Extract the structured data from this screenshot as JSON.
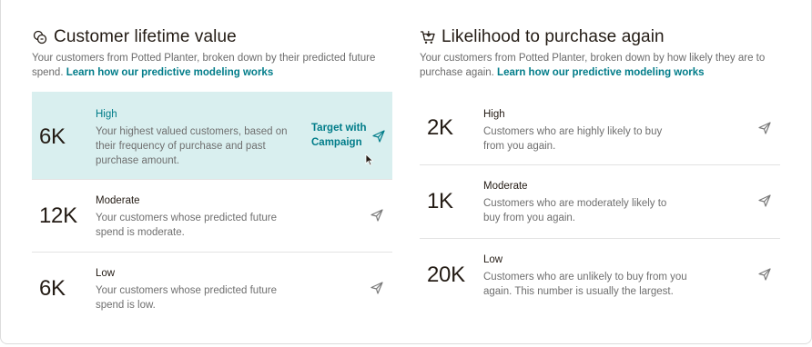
{
  "clv": {
    "icon": "coins-icon",
    "title": "Customer lifetime value",
    "desc": "Your customers from Potted Planter, broken down by their predicted future spend.",
    "link": "Learn how our predictive modeling works",
    "rows": [
      {
        "value": "6K",
        "label": "High",
        "desc": "Your highest valued customers, based on their frequency of purchase and past purchase amount.",
        "action": "Target with Campaign"
      },
      {
        "value": "12K",
        "label": "Moderate",
        "desc": "Your customers whose predicted future spend is moderate."
      },
      {
        "value": "6K",
        "label": "Low",
        "desc": "Your customers whose predicted future spend is low."
      }
    ]
  },
  "lpa": {
    "icon": "cart-icon",
    "title": "Likelihood to purchase again",
    "desc": "Your customers from Potted Planter, broken down by how likely they are to purchase again.",
    "link": "Learn how our predictive modeling works",
    "rows": [
      {
        "value": "2K",
        "label": "High",
        "desc": "Customers who are highly likely to buy from you again."
      },
      {
        "value": "1K",
        "label": "Moderate",
        "desc": "Customers who are moderately likely to buy from you again."
      },
      {
        "value": "20K",
        "label": "Low",
        "desc": "Customers who are unlikely to buy from you again. This number is usually the largest."
      }
    ]
  },
  "colors": {
    "accent": "#007c89",
    "highlight_bg": "#d9efef",
    "text": "#241c15",
    "muted": "#6f6f6f"
  }
}
